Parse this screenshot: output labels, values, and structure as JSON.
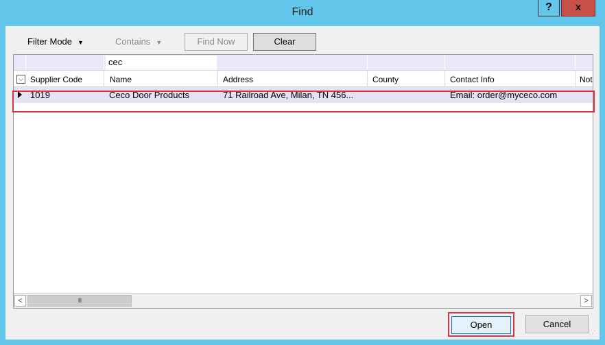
{
  "window": {
    "title": "Find",
    "help_label": "?",
    "close_label": "x"
  },
  "toolbar": {
    "filter_mode_label": "Filter Mode",
    "contains_label": "Contains",
    "find_now_label": "Find Now",
    "clear_label": "Clear"
  },
  "filter": {
    "name_value": "cec"
  },
  "columns": [
    "Supplier Code",
    "Name",
    "Address",
    "County",
    "Contact Info",
    "Not"
  ],
  "rows": [
    {
      "supplier_code": "1019",
      "name": "Ceco Door Products",
      "address": "71 Railroad Ave, Milan, TN  456...",
      "county": "",
      "contact_info": "Email: order@myceco.com"
    }
  ],
  "scrollbar": {
    "left_arrow": "<",
    "right_arrow": ">",
    "thumb_grip": "III"
  },
  "footer": {
    "open_label": "Open",
    "cancel_label": "Cancel"
  },
  "colors": {
    "title_bar": "#62c6ea",
    "close_button": "#c7504a",
    "selected_row": "#e3e3f5",
    "highlight_border": "#d9343f"
  }
}
